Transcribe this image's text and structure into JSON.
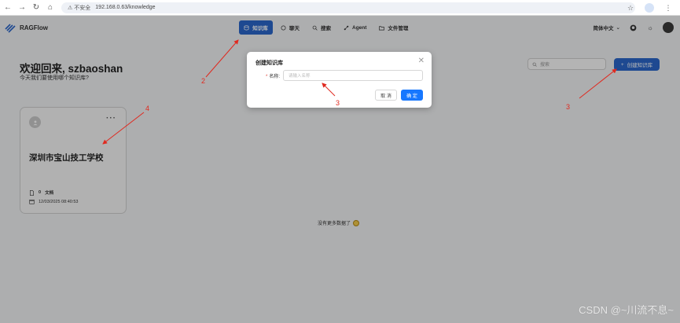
{
  "browser": {
    "security": "不安全",
    "url": "192.168.0.63/knowledge"
  },
  "header": {
    "app_name": "RAGFlow",
    "nav": [
      {
        "label": "知识库",
        "active": true,
        "icon": "database-icon"
      },
      {
        "label": "聊天",
        "icon": "chat-icon"
      },
      {
        "label": "搜索",
        "icon": "search-icon"
      },
      {
        "label": "Agent",
        "icon": "agent-icon"
      },
      {
        "label": "文件管理",
        "icon": "folder-icon"
      }
    ],
    "language": "简体中文"
  },
  "page": {
    "welcome": "欢迎回来, szbaoshan",
    "subtitle": "今天我们要使用哪个知识库?",
    "search_placeholder": "搜索",
    "create_button": "创建知识库",
    "footer_text": "没有更多数据了"
  },
  "knowledge_cards": [
    {
      "name": "深圳市宝山技工学校",
      "doc_count": "0",
      "doc_label": "文档",
      "date": "12/03/2025 08:40:53"
    }
  ],
  "modal": {
    "title": "创建知识库",
    "field_label": "名称:",
    "field_placeholder": "请输入名称",
    "cancel": "取 消",
    "confirm": "确 定"
  },
  "annotations": {
    "a1": "2",
    "a2": "3",
    "a3": "3",
    "a4": "4"
  },
  "watermark": "CSDN @~川流不息~",
  "colors": {
    "primary": "#2a66c9",
    "confirm": "#1677ff",
    "annotation": "#e0291f"
  }
}
